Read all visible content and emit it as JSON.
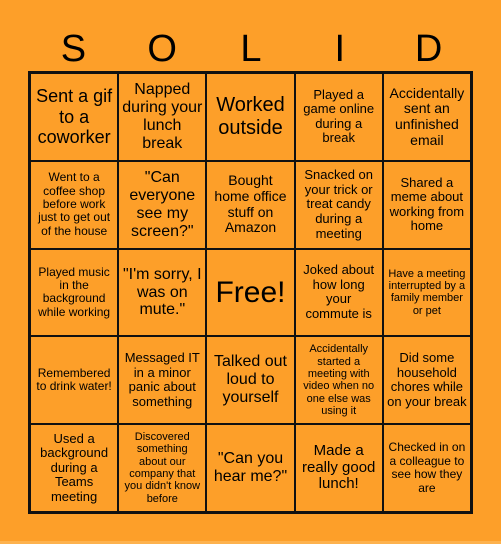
{
  "header": {
    "letters": [
      "S",
      "O",
      "L",
      "I",
      "D"
    ]
  },
  "board": {
    "cells": [
      [
        "Sent a gif to a coworker",
        "Napped during your lunch break",
        "Worked outside",
        "Played a game online during a break",
        "Accidentally sent an unfinished email"
      ],
      [
        "Went to a coffee shop before work just to get out of the house",
        "\"Can everyone see my screen?\"",
        "Bought home office stuff on Amazon",
        "Snacked on your trick or treat candy during a meeting",
        "Shared a meme about working from home"
      ],
      [
        "Played music in the background while working",
        "\"I'm sorry, I was on mute.\"",
        "Free!",
        "Joked about how long your commute is",
        "Have a meeting interrupted by a family member or pet"
      ],
      [
        "Remembered to drink water!",
        "Messaged IT in a minor panic about something",
        "Talked out loud to yourself",
        "Accidentally started a meeting with video when no one else was using it",
        "Did some household chores while on your break"
      ],
      [
        "Used a background during a Teams meeting",
        "Discovered something about our company that you didn't know before",
        "\"Can you hear me?\"",
        "Made a really good lunch!",
        "Checked in on a colleague to see how they are"
      ]
    ]
  },
  "colors": {
    "background": "#fd9f29",
    "grid_lines": "#111111",
    "text": "#000000"
  }
}
